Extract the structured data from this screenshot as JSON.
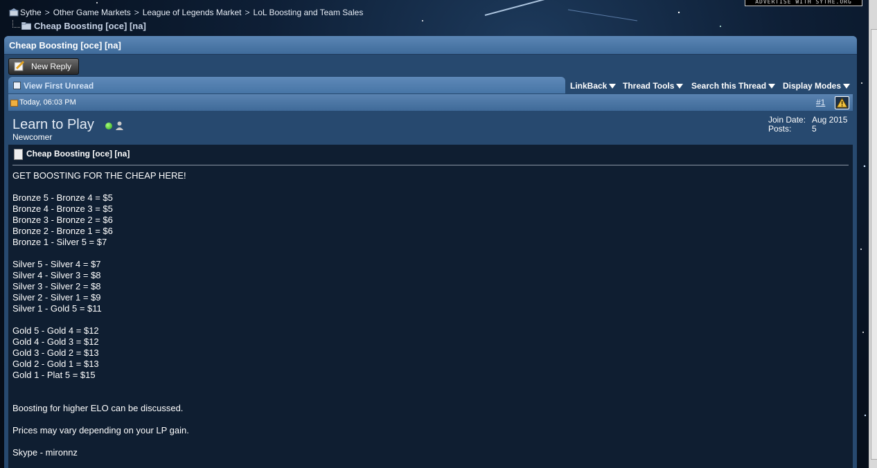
{
  "ad_banner": "ADVERTISE WITH SYTHE.ORG",
  "breadcrumb": [
    "Sythe",
    "Other Game Markets",
    "League of Legends Market",
    "LoL Boosting and Team Sales"
  ],
  "thread_crumb": "Cheap Boosting [oce] [na]",
  "panel_title": "Cheap Boosting [oce] [na]",
  "new_reply_label": "New Reply",
  "toolbar": {
    "view_first_unread": "View First Unread",
    "linkback": "LinkBack",
    "thread_tools": "Thread Tools",
    "search_thread": "Search this Thread",
    "display_modes": "Display Modes"
  },
  "post": {
    "date": "Today, 06:03 PM",
    "number": "#1",
    "username": "Learn to Play",
    "usertitle": "Newcomer",
    "join_date_label": "Join Date:",
    "join_date": "Aug 2015",
    "posts_label": "Posts:",
    "posts": "5",
    "title": "Cheap Boosting [oce] [na]",
    "lines": [
      "GET BOOSTING FOR THE CHEAP HERE!",
      "",
      "Bronze 5 - Bronze 4 = $5",
      "Bronze 4 - Bronze 3 = $5",
      "Bronze 3 - Bronze 2 = $6",
      "Bronze 2 - Bronze 1 = $6",
      "Bronze 1 - Silver 5 = $7",
      "",
      "Silver 5 - Silver 4 = $7",
      "Silver 4 - Silver 3 = $8",
      "Silver 3 - Silver 2 = $8",
      "Silver 2 - Silver 1 = $9",
      "Silver 1 - Gold 5 = $11",
      "",
      "Gold 5 - Gold 4 = $12",
      "Gold 4 - Gold 3 = $12",
      "Gold 3 - Gold 2 = $13",
      "Gold 2 - Gold 1 = $13",
      "Gold 1 - Plat 5 = $15",
      "",
      "",
      "Boosting for higher ELO can be discussed.",
      "",
      "Prices may vary depending on your LP gain.",
      "",
      "Skype - mironnz"
    ]
  }
}
